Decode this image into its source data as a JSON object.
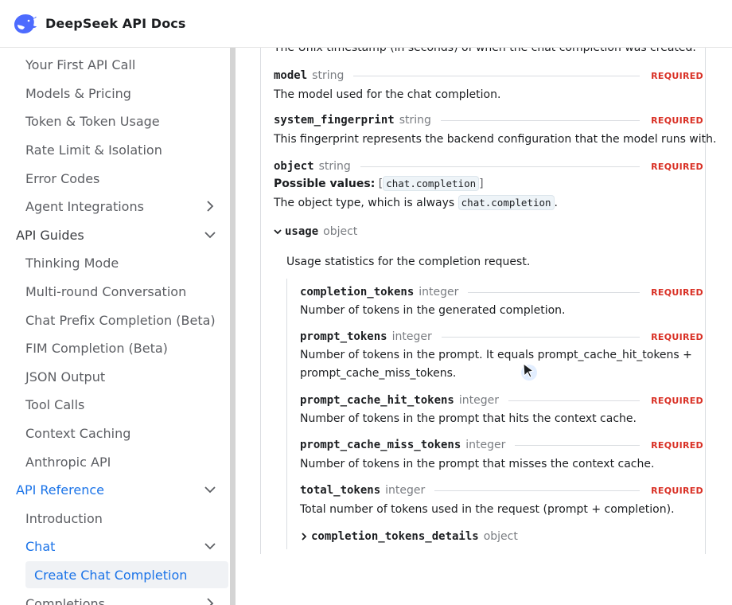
{
  "header": {
    "title": "DeepSeek API Docs",
    "logo_icon": "whale-logo-icon",
    "accent": "#4d6bfe"
  },
  "sidebar": {
    "items": [
      {
        "label": "Your First API Call"
      },
      {
        "label": "Models & Pricing"
      },
      {
        "label": "Token & Token Usage"
      },
      {
        "label": "Rate Limit & Isolation"
      },
      {
        "label": "Error Codes"
      },
      {
        "label": "Agent Integrations",
        "icon": "chevron-right-icon"
      },
      {
        "label": "API Guides",
        "icon": "chevron-down-icon"
      },
      {
        "label": "Thinking Mode"
      },
      {
        "label": "Multi-round Conversation"
      },
      {
        "label": "Chat Prefix Completion (Beta)"
      },
      {
        "label": "FIM Completion (Beta)"
      },
      {
        "label": "JSON Output"
      },
      {
        "label": "Tool Calls"
      },
      {
        "label": "Context Caching"
      },
      {
        "label": "Anthropic API"
      },
      {
        "label": "API Reference",
        "icon": "chevron-down-icon"
      },
      {
        "label": "Introduction"
      },
      {
        "label": "Chat",
        "icon": "chevron-down-icon"
      },
      {
        "label": "Create Chat Completion"
      },
      {
        "label": "Completions",
        "icon": "chevron-right-icon"
      }
    ],
    "active_color": "#1a73e8"
  },
  "content": {
    "created_desc": "The Unix timestamp (in seconds) of when the chat completion was created.",
    "required_label": "REQUIRED",
    "params": {
      "model": {
        "name": "model",
        "type": "string",
        "desc": "The model used for the chat completion."
      },
      "system_fingerprint": {
        "name": "system_fingerprint",
        "type": "string",
        "desc": "This fingerprint represents the backend configuration that the model runs with."
      },
      "object": {
        "name": "object",
        "type": "string",
        "possible_label": "Possible values:",
        "possible_value": "chat.completion",
        "desc_prefix": "The object type, which is always",
        "desc_code": "chat.completion",
        "desc_suffix": "."
      },
      "usage": {
        "name": "usage",
        "type": "object",
        "desc": "Usage statistics for the completion request."
      }
    },
    "usage_fields": {
      "completion_tokens": {
        "name": "completion_tokens",
        "type": "integer",
        "desc": "Number of tokens in the generated completion."
      },
      "prompt_tokens": {
        "name": "prompt_tokens",
        "type": "integer",
        "desc1": "Number of tokens in the prompt. It equals prompt_cache_hit_tokens +",
        "desc2": "prompt_cache_miss_tokens."
      },
      "prompt_cache_hit_tokens": {
        "name": "prompt_cache_hit_tokens",
        "type": "integer",
        "desc": "Number of tokens in the prompt that hits the context cache."
      },
      "prompt_cache_miss_tokens": {
        "name": "prompt_cache_miss_tokens",
        "type": "integer",
        "desc": "Number of tokens in the prompt that misses the context cache."
      },
      "total_tokens": {
        "name": "total_tokens",
        "type": "integer",
        "desc": "Total number of tokens used in the request (prompt + completion)."
      },
      "completion_tokens_details": {
        "name": "completion_tokens_details",
        "type": "object"
      }
    },
    "required_color": "#d93025"
  }
}
